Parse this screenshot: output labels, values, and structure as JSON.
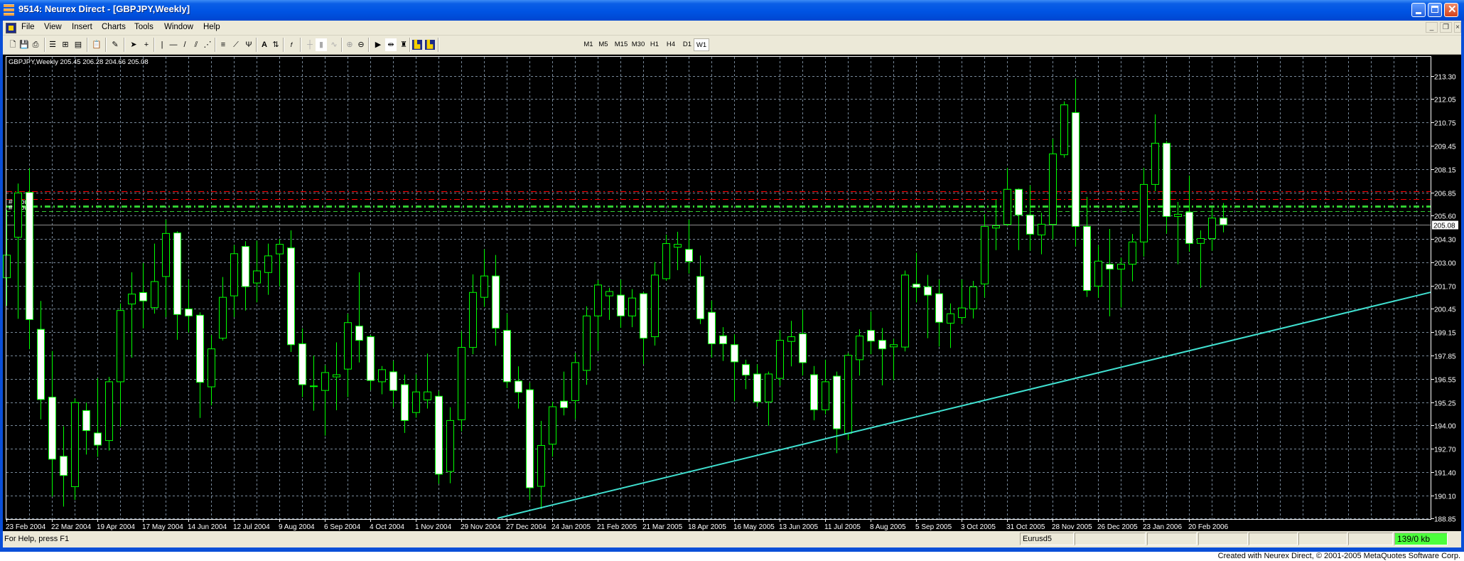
{
  "window": {
    "title": "9514: Neurex Direct - [GBPJPY,Weekly]",
    "controls": [
      "minimize",
      "maximize",
      "close"
    ]
  },
  "menu": {
    "items": [
      "File",
      "View",
      "Insert",
      "Charts",
      "Tools",
      "Window",
      "Help"
    ]
  },
  "toolbar": {
    "timeframes": [
      "M1",
      "M5",
      "M15",
      "M30",
      "H1",
      "H4",
      "D1",
      "W1"
    ],
    "active_timeframe": "W1"
  },
  "chart_header": {
    "text": "GBPJPY,Weekly  205.45 206.28 204.66 205.08"
  },
  "order_labels": [
    "#   3 buy",
    "#   3 buy"
  ],
  "status": {
    "help": "For Help, press F1",
    "profile": "Eurusd5",
    "traffic": "139/0 kb",
    "traffic_color": "#4cff3c"
  },
  "footer": "Created with Neurex Direct, © 2001-2005 MetaQuotes Software Corp.",
  "chart_data": {
    "type": "candlestick",
    "symbol": "GBPJPY",
    "period": "Weekly",
    "colors": {
      "background": "#000000",
      "candle_outline": "#00ff00",
      "bull_body": "#000000",
      "bear_body": "#ffffff",
      "grid": "#778899",
      "trendline": "#40e0d0",
      "order_level": "#ff0000",
      "order_open": "#32cd32"
    },
    "ylim": [
      188.85,
      213.3
    ],
    "grid": true,
    "y_ticks": [
      "213.30",
      "212.05",
      "210.75",
      "209.45",
      "208.15",
      "206.85",
      "205.60",
      "204.30",
      "203.00",
      "201.70",
      "200.45",
      "199.15",
      "197.85",
      "196.55",
      "195.25",
      "194.00",
      "192.70",
      "191.40",
      "190.10",
      "188.85"
    ],
    "x_ticks": [
      "23 Feb 2004",
      "22 Mar 2004",
      "19 Apr 2004",
      "17 May 2004",
      "14 Jun 2004",
      "12 Jul 2004",
      "9 Aug 2004",
      "6 Sep 2004",
      "4 Oct 2004",
      "1 Nov 2004",
      "29 Nov 2004",
      "27 Dec 2004",
      "24 Jan 2005",
      "21 Feb 2005",
      "21 Mar 2005",
      "18 Apr 2005",
      "16 May 2005",
      "13 Jun 2005",
      "11 Jul 2005",
      "8 Aug 2005",
      "5 Sep 2005",
      "3 Oct 2005",
      "31 Oct 2005",
      "28 Nov 2005",
      "26 Dec 2005",
      "23 Jan 2006",
      "20 Feb 2006"
    ],
    "current_price": "205.08",
    "levels": [
      {
        "price": 206.94,
        "style": "red-dashdot"
      },
      {
        "price": 206.49,
        "style": "red-dashdot"
      },
      {
        "price": 206.1,
        "style": "green-dashdot-thick"
      },
      {
        "price": 205.82,
        "style": "green-dash"
      }
    ],
    "trendline": [
      {
        "date": "2005-01-03",
        "price": 189.13
      },
      {
        "date": "2006-03-13",
        "price": 198.57
      }
    ],
    "candles_columns": [
      "date",
      "open",
      "high",
      "low",
      "close"
    ],
    "candles": [
      [
        "2004-02-23",
        202.15,
        205.9,
        200.6,
        203.4
      ],
      [
        "2004-03-01",
        204.39,
        207.36,
        199.88,
        206.84
      ],
      [
        "2004-03-08",
        206.87,
        208.2,
        198.2,
        199.84
      ],
      [
        "2004-03-15",
        199.3,
        200.87,
        194.32,
        195.42
      ],
      [
        "2004-03-22",
        195.55,
        198.1,
        190.05,
        192.12
      ],
      [
        "2004-03-29",
        192.28,
        193.94,
        189.5,
        191.22
      ],
      [
        "2004-04-05",
        190.6,
        195.48,
        189.87,
        195.25
      ],
      [
        "2004-04-12",
        194.81,
        195.25,
        192.38,
        193.7
      ],
      [
        "2004-04-19",
        193.57,
        196.6,
        192.25,
        192.9
      ],
      [
        "2004-04-26",
        193.15,
        196.67,
        192.6,
        196.4
      ],
      [
        "2004-05-03",
        196.4,
        200.73,
        193.9,
        200.34
      ],
      [
        "2004-05-10",
        200.7,
        202.45,
        197.73,
        201.25
      ],
      [
        "2004-05-17",
        201.33,
        202.97,
        199.35,
        200.87
      ],
      [
        "2004-05-24",
        200.5,
        204.04,
        200.17,
        201.94
      ],
      [
        "2004-05-31",
        202.22,
        205.36,
        199.97,
        204.6
      ],
      [
        "2004-06-07",
        204.63,
        204.72,
        198.72,
        200.12
      ],
      [
        "2004-06-14",
        200.43,
        202.06,
        199.12,
        200.04
      ],
      [
        "2004-06-21",
        200.08,
        200.24,
        194.4,
        196.37
      ],
      [
        "2004-06-28",
        196.12,
        198.98,
        195.09,
        198.22
      ],
      [
        "2004-07-05",
        198.81,
        202.19,
        198.68,
        201.07
      ],
      [
        "2004-07-12",
        201.15,
        203.96,
        199.97,
        203.48
      ],
      [
        "2004-07-19",
        203.88,
        204.17,
        200.34,
        201.66
      ],
      [
        "2004-07-26",
        201.86,
        204.2,
        200.79,
        202.53
      ],
      [
        "2004-08-02",
        202.44,
        204.04,
        201.21,
        203.36
      ],
      [
        "2004-08-09",
        203.47,
        204.3,
        201.66,
        204.0
      ],
      [
        "2004-08-16",
        203.8,
        204.77,
        198.05,
        198.45
      ],
      [
        "2004-08-23",
        198.5,
        199.35,
        195.55,
        196.24
      ],
      [
        "2004-08-30",
        196.16,
        197.84,
        194.8,
        196.17
      ],
      [
        "2004-09-06",
        195.92,
        197.31,
        193.42,
        196.91
      ],
      [
        "2004-09-13",
        196.67,
        198.58,
        194.83,
        196.79
      ],
      [
        "2004-09-20",
        197.1,
        200.16,
        195.55,
        199.67
      ],
      [
        "2004-09-27",
        199.48,
        202.45,
        197.47,
        198.69
      ],
      [
        "2004-10-04",
        198.89,
        198.98,
        195.94,
        196.47
      ],
      [
        "2004-10-11",
        196.4,
        197.27,
        195.71,
        197.07
      ],
      [
        "2004-10-18",
        196.95,
        197.55,
        194.99,
        195.92
      ],
      [
        "2004-10-25",
        196.24,
        196.8,
        193.57,
        194.26
      ],
      [
        "2004-11-01",
        194.7,
        196.8,
        194.41,
        195.84
      ],
      [
        "2004-11-08",
        195.4,
        197.96,
        194.92,
        195.84
      ],
      [
        "2004-11-15",
        195.6,
        195.88,
        190.76,
        191.29
      ],
      [
        "2004-11-22",
        191.44,
        194.99,
        190.79,
        194.26
      ],
      [
        "2004-11-29",
        194.3,
        199.2,
        193.66,
        198.3
      ],
      [
        "2004-12-06",
        198.3,
        202.34,
        197.92,
        201.34
      ],
      [
        "2004-12-13",
        201.07,
        203.73,
        200.54,
        202.25
      ],
      [
        "2004-12-20",
        202.25,
        203.41,
        198.39,
        199.36
      ],
      [
        "2004-12-27",
        199.24,
        200.17,
        196.05,
        196.4
      ],
      [
        "2005-01-03",
        196.44,
        197.25,
        194.92,
        195.82
      ],
      [
        "2005-01-10",
        195.96,
        196.35,
        189.86,
        190.54
      ],
      [
        "2005-01-17",
        190.62,
        194.24,
        189.36,
        192.88
      ],
      [
        "2005-01-24",
        192.95,
        195.3,
        192.26,
        195.02
      ],
      [
        "2005-01-31",
        195.33,
        196.96,
        194.54,
        194.97
      ],
      [
        "2005-02-07",
        195.36,
        197.99,
        194.33,
        197.46
      ],
      [
        "2005-02-14",
        197.03,
        200.57,
        196.23,
        200.04
      ],
      [
        "2005-02-21",
        200.04,
        202.02,
        198.1,
        201.75
      ],
      [
        "2005-02-28",
        201.15,
        201.6,
        199.82,
        201.39
      ],
      [
        "2005-03-07",
        201.19,
        202.05,
        199.38,
        200.04
      ],
      [
        "2005-03-14",
        200.04,
        201.52,
        199.42,
        201.03
      ],
      [
        "2005-03-21",
        201.27,
        201.36,
        197.37,
        198.81
      ],
      [
        "2005-03-28",
        198.89,
        203.02,
        198.4,
        202.3
      ],
      [
        "2005-04-04",
        202.1,
        204.53,
        201.99,
        204.04
      ],
      [
        "2005-04-11",
        203.84,
        204.69,
        202.57,
        204.0
      ],
      [
        "2005-04-18",
        203.72,
        205.36,
        202.38,
        203.05
      ],
      [
        "2005-04-25",
        202.22,
        203.38,
        199.59,
        199.88
      ],
      [
        "2005-05-02",
        200.24,
        200.89,
        197.73,
        198.5
      ],
      [
        "2005-05-09",
        198.94,
        199.42,
        197.55,
        198.5
      ],
      [
        "2005-05-16",
        198.45,
        199.02,
        195.32,
        197.5
      ],
      [
        "2005-05-23",
        197.35,
        197.62,
        195.99,
        196.77
      ],
      [
        "2005-05-30",
        196.83,
        197.36,
        195.02,
        195.29
      ],
      [
        "2005-06-06",
        195.29,
        196.96,
        193.97,
        196.83
      ],
      [
        "2005-06-13",
        196.59,
        199.24,
        196.18,
        198.69
      ],
      [
        "2005-06-20",
        198.63,
        199.77,
        197.25,
        198.89
      ],
      [
        "2005-06-27",
        199.05,
        200.37,
        196.74,
        197.46
      ],
      [
        "2005-07-04",
        196.79,
        197.27,
        194.27,
        194.85
      ],
      [
        "2005-07-11",
        194.85,
        197.62,
        194.6,
        196.4
      ],
      [
        "2005-07-18",
        196.71,
        196.96,
        192.45,
        193.8
      ],
      [
        "2005-07-25",
        193.55,
        197.99,
        193.18,
        197.86
      ],
      [
        "2005-08-01",
        197.62,
        199.3,
        196.74,
        198.93
      ],
      [
        "2005-08-08",
        199.24,
        200.29,
        197.92,
        198.65
      ],
      [
        "2005-08-15",
        198.69,
        199.37,
        196.2,
        198.22
      ],
      [
        "2005-08-22",
        198.33,
        198.78,
        196.48,
        198.45
      ],
      [
        "2005-08-29",
        198.32,
        202.55,
        198.08,
        202.3
      ],
      [
        "2005-09-05",
        201.8,
        203.53,
        200.79,
        201.62
      ],
      [
        "2005-09-12",
        201.65,
        202.31,
        198.81,
        201.19
      ],
      [
        "2005-09-19",
        201.27,
        202.05,
        198.35,
        199.69
      ],
      [
        "2005-09-26",
        199.64,
        200.73,
        198.27,
        200.16
      ],
      [
        "2005-10-03",
        199.95,
        202.06,
        199.59,
        200.48
      ],
      [
        "2005-10-10",
        200.43,
        201.98,
        199.9,
        201.65
      ],
      [
        "2005-10-17",
        201.81,
        205.67,
        201.06,
        204.99
      ],
      [
        "2005-10-24",
        204.9,
        206.46,
        203.68,
        205.03
      ],
      [
        "2005-10-31",
        205.1,
        208.23,
        205.0,
        207.04
      ],
      [
        "2005-11-07",
        207.04,
        207.09,
        203.68,
        205.62
      ],
      [
        "2005-11-14",
        205.62,
        207.26,
        203.64,
        204.56
      ],
      [
        "2005-11-21",
        204.52,
        205.74,
        203.45,
        205.11
      ],
      [
        "2005-11-28",
        205.1,
        209.84,
        204.27,
        209.0
      ],
      [
        "2005-12-05",
        208.95,
        211.9,
        208.79,
        211.71
      ],
      [
        "2005-12-12",
        211.28,
        213.15,
        203.88,
        204.99
      ],
      [
        "2005-12-19",
        204.99,
        206.62,
        201.09,
        201.45
      ],
      [
        "2005-12-26",
        201.69,
        203.94,
        201.04,
        203.07
      ],
      [
        "2006-01-02",
        202.9,
        204.85,
        200.02,
        202.63
      ],
      [
        "2006-01-09",
        202.63,
        203.26,
        200.5,
        202.9
      ],
      [
        "2006-01-16",
        202.9,
        204.57,
        201.95,
        204.13
      ],
      [
        "2006-01-23",
        204.13,
        208.23,
        203.32,
        207.31
      ],
      [
        "2006-01-30",
        207.31,
        211.18,
        206.93,
        209.59
      ],
      [
        "2006-02-06",
        209.59,
        209.71,
        204.59,
        205.54
      ],
      [
        "2006-02-13",
        205.54,
        206.34,
        202.9,
        205.66
      ],
      [
        "2006-02-20",
        205.78,
        207.8,
        203.59,
        204.05
      ],
      [
        "2006-02-27",
        204.05,
        204.77,
        201.59,
        204.32
      ],
      [
        "2006-03-06",
        204.32,
        206.01,
        203.64,
        205.45
      ],
      [
        "2006-03-13",
        205.45,
        206.28,
        204.66,
        205.08
      ]
    ]
  }
}
